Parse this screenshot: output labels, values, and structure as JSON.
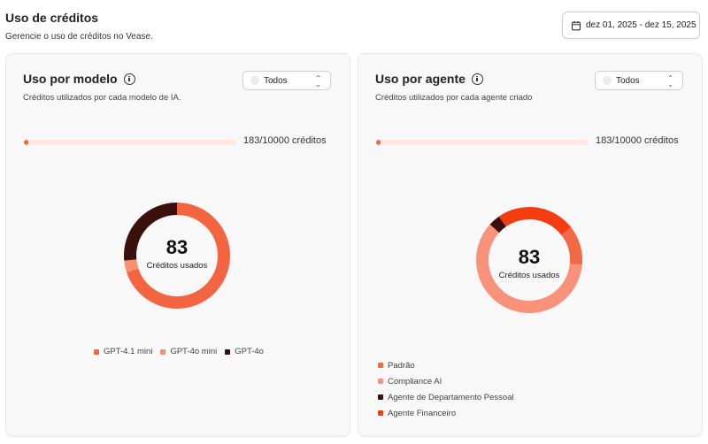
{
  "header": {
    "title": "Uso de créditos",
    "subtitle": "Gerencie o uso de créditos no Vease.",
    "date_range": "dez 01, 2025 - dez 15, 2025",
    "date_icon": "calendar-icon"
  },
  "model_card": {
    "title": "Uso por modelo",
    "info_icon": "info-icon",
    "subtitle": "Créditos utilizados por cada modelo de IA.",
    "filter_value": "Todos",
    "progress_text": "183/10000 créditos",
    "progress_fraction": 0.0183,
    "total_value": "83",
    "total_label": "Créditos usados",
    "chart_data": {
      "type": "pie",
      "categories": [
        "GPT-4.1 mini",
        "GPT-4o mini",
        "GPT-4o"
      ],
      "values": [
        58,
        3,
        22
      ],
      "colors": [
        "#f26540",
        "#f7906f",
        "#3b100b"
      ]
    }
  },
  "agent_card": {
    "title": "Uso por agente",
    "info_icon": "info-icon",
    "subtitle": "Créditos utilizados por cada agente criado",
    "filter_value": "Todos",
    "progress_text": "183/10000 créditos",
    "progress_fraction": 0.0183,
    "total_value": "83",
    "total_label": "Créditos usados",
    "chart_data": {
      "type": "pie",
      "categories": [
        "Padrão",
        "Compliance AI",
        "Agente de Departamento Pessoal",
        "Agente Financeiro"
      ],
      "values": [
        10,
        50,
        3,
        20
      ],
      "colors": [
        "#f26a45",
        "#f8927a",
        "#3b100b",
        "#f33c0f"
      ]
    }
  }
}
